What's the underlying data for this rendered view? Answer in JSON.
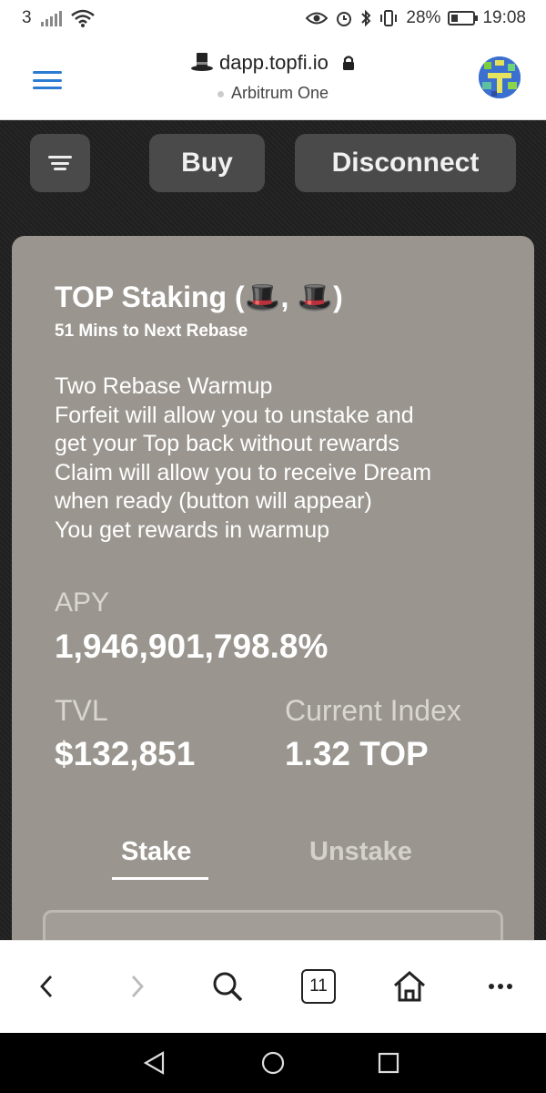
{
  "status_bar": {
    "carrier_slot": "3",
    "battery": "28%",
    "time": "19:08"
  },
  "browser": {
    "site_icon": "top-hat-icon",
    "url": "dapp.topfi.io",
    "network": "Arbitrum One",
    "accent_color": "#2b7bd3"
  },
  "nav": {
    "buy_label": "Buy",
    "disconnect_label": "Disconnect"
  },
  "staking": {
    "title": "TOP Staking (🎩, 🎩)",
    "subtitle": "51 Mins to Next Rebase",
    "description_lines": [
      "Two Rebase Warmup",
      "Forfeit will allow you to unstake and",
      "get your Top back without rewards",
      "Claim will allow you to receive Dream",
      "when ready (button will appear)",
      "You get rewards in warmup"
    ],
    "apy_label": "APY",
    "apy_value": "1,946,901,798.8%",
    "tvl_label": "TVL",
    "tvl_value": "$132,851",
    "index_label": "Current Index",
    "index_value": "1.32 TOP",
    "tabs": [
      "Stake",
      "Unstake"
    ],
    "active_tab": "Stake"
  },
  "toolbar": {
    "tab_count": "11",
    "icons": [
      "back-icon",
      "forward-icon",
      "search-icon",
      "tabs-icon",
      "home-icon",
      "more-icon"
    ]
  }
}
